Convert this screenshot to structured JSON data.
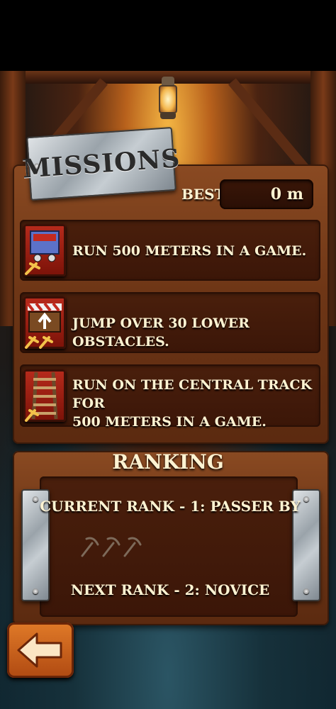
{
  "missions": {
    "title": "MISSIONS",
    "best_label": "BEST",
    "best_value": "0 m",
    "items": [
      {
        "icon": "mine-cart-icon",
        "lines": [
          "RUN 500 METERS IN A GAME."
        ]
      },
      {
        "icon": "jump-obstacle-icon",
        "lines": [
          "JUMP OVER 30 LOWER OBSTACLES."
        ]
      },
      {
        "icon": "rail-track-icon",
        "lines": [
          "RUN ON THE CENTRAL TRACK FOR",
          "500 METERS IN A GAME."
        ]
      }
    ]
  },
  "ranking": {
    "title": "RANKING",
    "current": "CURRENT RANK - 1: PASSER BY",
    "next": "NEXT RANK - 2: NOVICE",
    "picks_total": 3,
    "picks_earned": 0
  },
  "nav": {
    "back_icon": "back-arrow-icon"
  }
}
